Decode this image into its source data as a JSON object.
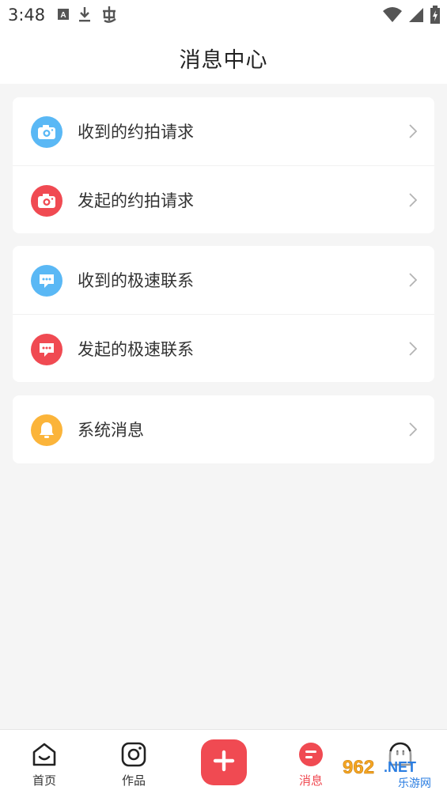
{
  "status_bar": {
    "time": "3:48",
    "left_icons": [
      "keyboard-a-icon",
      "download-icon",
      "bug-icon"
    ],
    "right_icons": [
      "wifi-icon",
      "signal-icon",
      "battery-icon"
    ]
  },
  "header": {
    "title": "消息中心"
  },
  "groups": [
    {
      "items": [
        {
          "label": "收到的约拍请求",
          "icon": "camera-icon",
          "color": "#5ab8f5"
        },
        {
          "label": "发起的约拍请求",
          "icon": "camera-icon",
          "color": "#f04a52"
        }
      ]
    },
    {
      "items": [
        {
          "label": "收到的极速联系",
          "icon": "chat-bubble-icon",
          "color": "#5ab8f5"
        },
        {
          "label": "发起的极速联系",
          "icon": "chat-bubble-icon",
          "color": "#f04a52"
        }
      ]
    },
    {
      "items": [
        {
          "label": "系统消息",
          "icon": "bell-icon",
          "color": "#fbb43a"
        }
      ]
    }
  ],
  "tabbar": {
    "tabs": [
      {
        "label": "首页",
        "icon": "home-face-icon",
        "active": false
      },
      {
        "label": "作品",
        "icon": "camera-outline-icon",
        "active": false
      },
      {
        "label": "",
        "icon": "plus-icon",
        "active": false
      },
      {
        "label": "消息",
        "icon": "message-icon",
        "active": true
      },
      {
        "label": "",
        "icon": "profile-face-icon",
        "active": false
      }
    ],
    "active_color": "#f04a52"
  },
  "watermark": {
    "text": "962.NET",
    "subtext": "乐游网"
  },
  "colors": {
    "accent": "#f04a52",
    "blue": "#5ab8f5",
    "yellow": "#fbb43a",
    "background": "#f5f5f5"
  }
}
